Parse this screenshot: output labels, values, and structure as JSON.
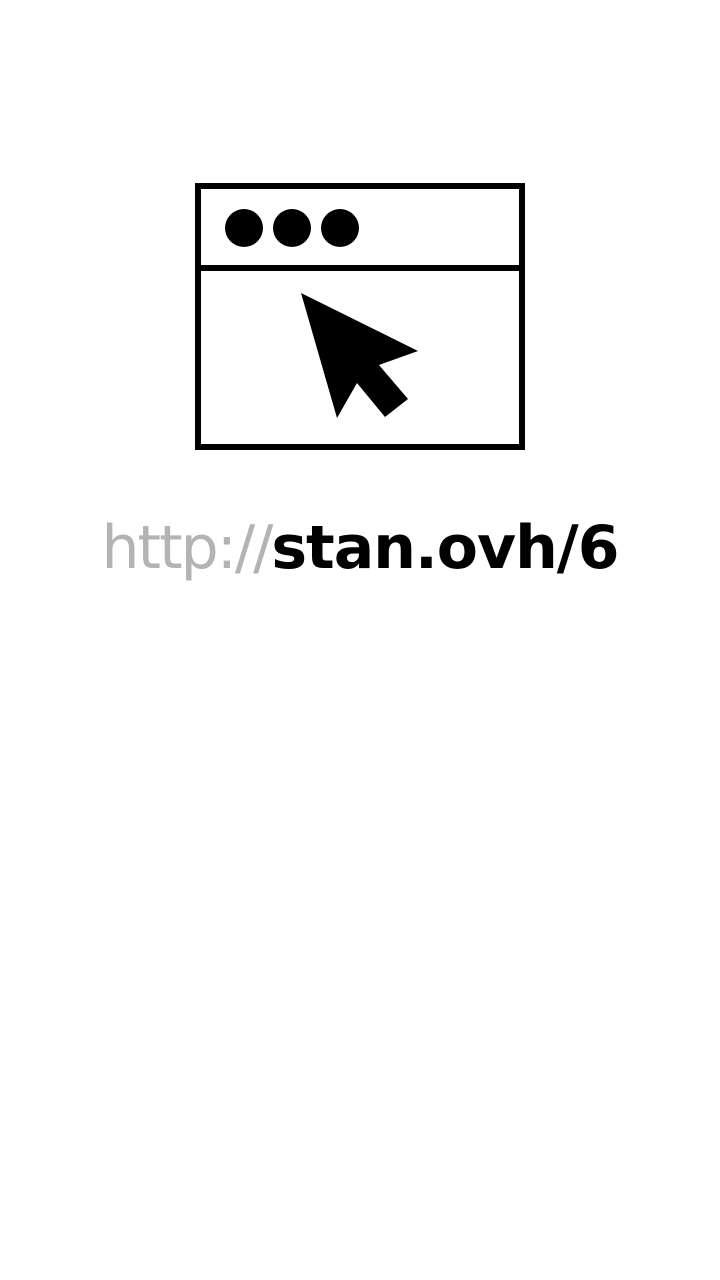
{
  "link": {
    "scheme": "http://",
    "host": "stan.ovh/6"
  },
  "icons": {
    "browser": "browser-window-icon",
    "cursor": "mouse-pointer-icon"
  },
  "colors": {
    "background": "#ffffff",
    "foreground": "#000000",
    "scheme_text": "#b3b3b3"
  }
}
